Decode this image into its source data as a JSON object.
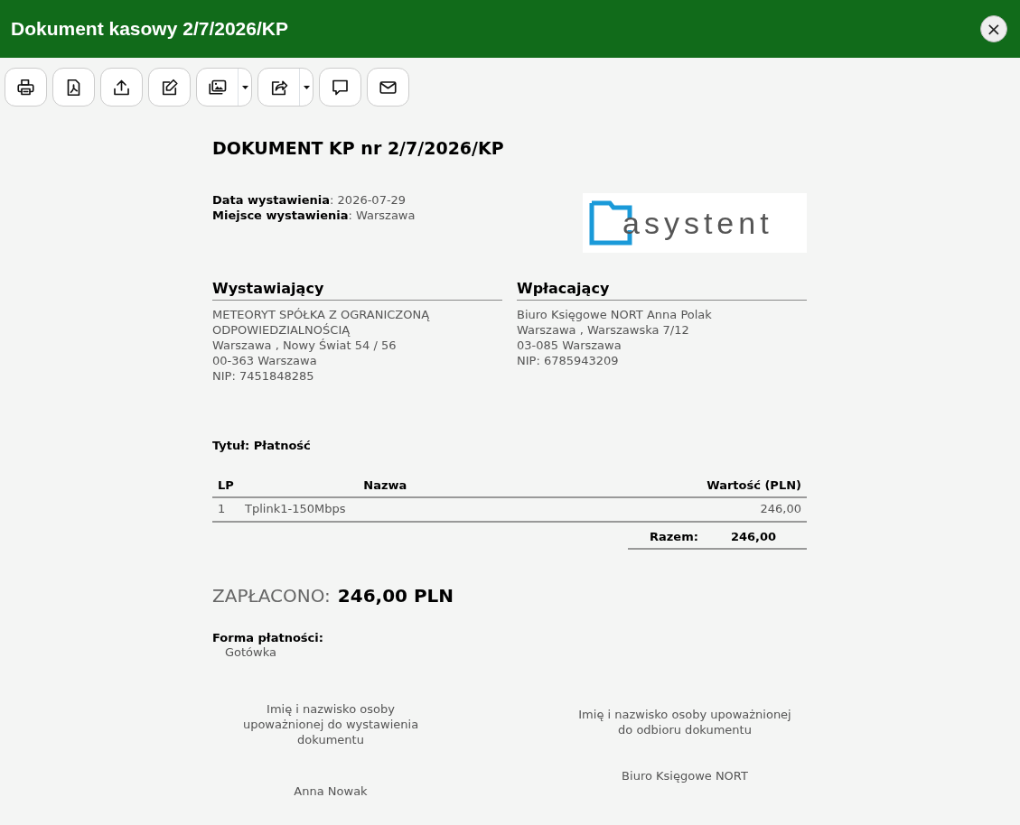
{
  "window": {
    "title": "Dokument kasowy 2/7/2026/KP",
    "close": "×"
  },
  "toolbar": [
    {
      "dropdown": false
    },
    {
      "dropdown": false
    },
    {
      "dropdown": false
    },
    {
      "dropdown": false
    },
    {
      "dropdown": true
    },
    {
      "dropdown": true
    },
    {
      "dropdown": false
    },
    {
      "dropdown": false
    }
  ],
  "document": {
    "heading": "DOKUMENT KP nr 2/7/2026/KP",
    "meta": [
      {
        "label": "Data wystawienia",
        "separator": ":",
        "value": "2026-07-29"
      },
      {
        "label": "Miejsce wystawienia",
        "separator": ":",
        "value": "Warszawa"
      }
    ],
    "logo": {
      "text": "asystent"
    },
    "parties": [
      {
        "title": "Wystawiający",
        "lines": [
          "METEORYT SPÓŁKA Z OGRANICZONĄ ODPOWIEDZIALNOŚCIĄ",
          "Warszawa , Nowy Świat 54 / 56",
          "00-363 Warszawa",
          "NIP: 7451848285"
        ]
      },
      {
        "title": "Wpłacający",
        "lines": [
          "Biuro Księgowe NORT Anna Polak",
          "Warszawa , Warszawska 7/12",
          "03-085 Warszawa",
          "NIP: 6785943209"
        ]
      }
    ],
    "subject": "Tytuł: Płatność",
    "table": {
      "columns": [
        "LP",
        "Nazwa",
        "Wartość (PLN)"
      ],
      "rows": [
        [
          "1",
          "Tplink1-150Mbps",
          "246,00"
        ]
      ],
      "total_label": "Razem:",
      "total": "246,00"
    },
    "paid_label": "ZAPŁACONO:",
    "paid_amount": "246,00 PLN",
    "payment_label": "Forma płatności:",
    "payment_value": "Gotówka",
    "signatures": [
      {
        "caption": "Imię i nazwisko osoby upoważnionej do wystawienia dokumentu",
        "name": "Anna Nowak"
      },
      {
        "caption": "Imię i nazwisko osoby upoważnionej do odbioru dokumentu",
        "name": "Biuro Księgowe NORT"
      }
    ]
  }
}
